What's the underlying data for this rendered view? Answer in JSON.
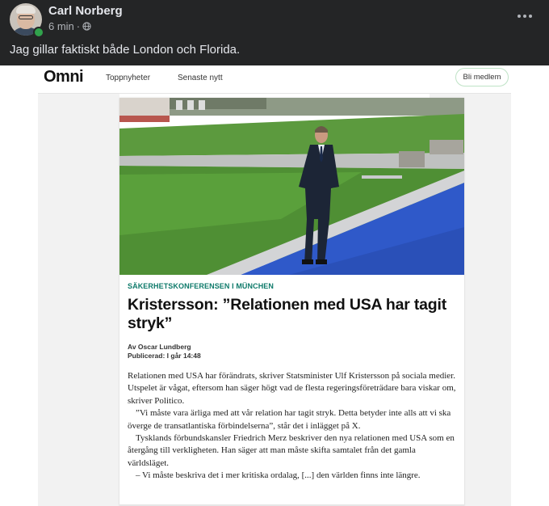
{
  "post": {
    "author": "Carl Norberg",
    "time": "6 min",
    "separator": "·",
    "text": "Jag gillar faktiskt både London och Florida."
  },
  "shared": {
    "site": {
      "logo": "Omni",
      "nav": [
        "Toppnyheter",
        "Senaste nytt"
      ],
      "member_button": "Bli medlem"
    },
    "article": {
      "kicker": "SÄKERHETSKONFERENSEN I MÜNCHEN",
      "headline": "Kristersson: ”Relationen med USA har tagit stryk”",
      "author": "Av Oscar Lundberg",
      "published": "Publicerad: I går 14:48",
      "paragraphs": [
        "Relationen med USA har förändrats, skriver Statsminister Ulf Kristersson på sociala medier. Utspelet är vågat, eftersom han säger högt vad de flesta regeringsföreträdare bara viskar om, skriver Politico.",
        "”Vi måste vara ärliga med att vår relation har tagit stryk. Detta betyder inte alls att vi ska överge de transatlantiska förbindelserna”, står det i inlägget på X.",
        "Tysklands förbundskansler Friedrich Merz beskriver den nya relationen med USA som en återgång till verkligheten. Han säger att man måste skifta samtalet från det gamla världsläget.",
        "– Vi måste beskriva det i mer kritiska ordalag, [...] den världen finns inte längre."
      ]
    }
  },
  "icons": {
    "globe": "globe-icon",
    "more": "more-horizontal-icon"
  },
  "colors": {
    "background": "#242526",
    "primary_text": "#e4e6eb",
    "secondary_text": "#b0b3b8",
    "online": "#31a24c",
    "kicker": "#0e7a6a"
  }
}
